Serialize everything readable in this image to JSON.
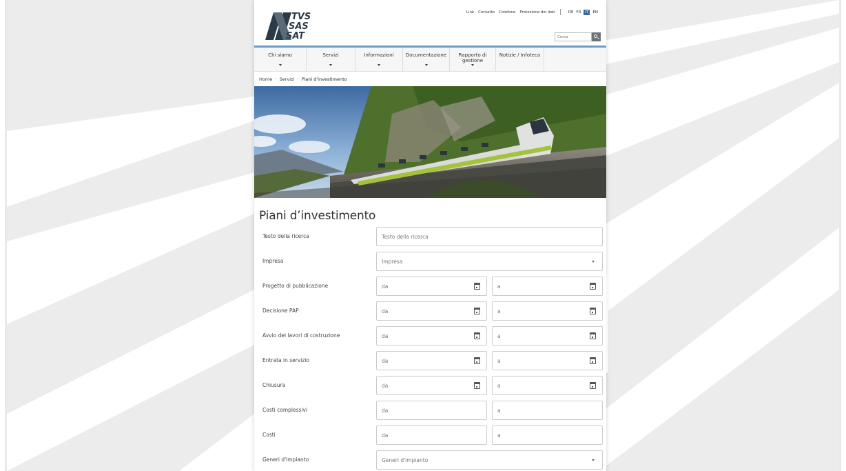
{
  "logo": {
    "lines": [
      "TVS",
      "SAS",
      "SAT"
    ]
  },
  "topnav": {
    "links": [
      "Link",
      "Contatto",
      "Colofone",
      "Protezione dei dati"
    ],
    "languages": [
      "DE",
      "FR",
      "IT",
      "EN"
    ],
    "active_language": "IT"
  },
  "search": {
    "placeholder": "Cerca"
  },
  "mainnav": {
    "items": [
      {
        "label": "Chi siamo"
      },
      {
        "label": "Servizi"
      },
      {
        "label": "Informazioni"
      },
      {
        "label": "Documentazione"
      },
      {
        "label": "Rapporto di gestione"
      },
      {
        "label": "Notizie / Infoteca"
      }
    ]
  },
  "breadcrumb": [
    "Home",
    "Servizi",
    "Piani d'investimento"
  ],
  "page": {
    "title": "Piani d’investimento"
  },
  "form": {
    "rows": [
      {
        "label": "Testo della ricerca",
        "placeholder": "Testo della ricerca"
      },
      {
        "label": "Impresa",
        "placeholder": "Impresa"
      },
      {
        "label": "Progetto di pubblicazione",
        "from": "da",
        "to": "a"
      },
      {
        "label": "Decisione PAP",
        "from": "da",
        "to": "a"
      },
      {
        "label": "Avvio dei lavori di costruzione",
        "from": "da",
        "to": "a"
      },
      {
        "label": "Entrata in servizio",
        "from": "da",
        "to": "a"
      },
      {
        "label": "Chiusura",
        "from": "da",
        "to": "a"
      },
      {
        "label": "Costi complessivi",
        "from": "da",
        "to": "a"
      },
      {
        "label": "Costi",
        "from": "da",
        "to": "a"
      },
      {
        "label": "Generi d'impianto",
        "placeholder": "Generi d'impianto"
      }
    ]
  },
  "colors": {
    "accent": "#6b9cc8",
    "logo": "#2c3a48",
    "page_bg": "#ececec"
  }
}
